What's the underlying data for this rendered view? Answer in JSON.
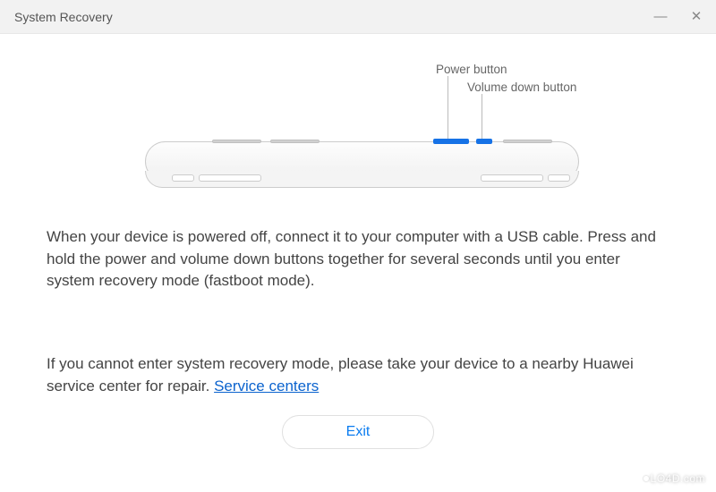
{
  "window": {
    "title": "System Recovery"
  },
  "diagram": {
    "power_label": "Power button",
    "volume_label": "Volume down button"
  },
  "instructions_text": "When your device is powered off, connect it to your computer with a USB cable. Press and hold the power and volume down buttons together for several seconds until you enter system recovery mode (fastboot mode).",
  "fallback_text": "If you cannot enter system recovery mode, please take your device to a nearby Huawei service center for repair. ",
  "link_text": "Service centers",
  "exit_label": "Exit",
  "watermark": "LO4D.com"
}
